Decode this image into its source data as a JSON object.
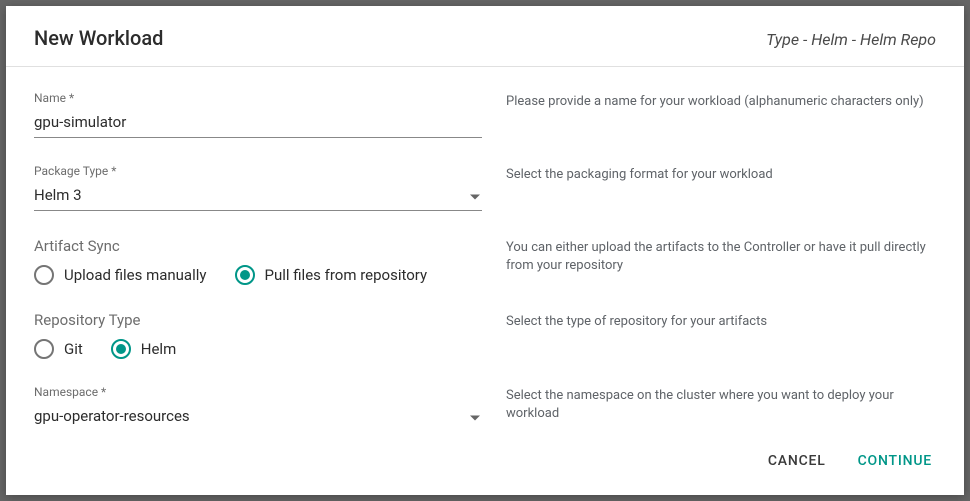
{
  "header": {
    "title": "New Workload",
    "subtitle": "Type - Helm - Helm Repo"
  },
  "fields": {
    "name": {
      "label": "Name *",
      "value": "gpu-simulator",
      "help": "Please provide a name for your workload (alphanumeric characters only)"
    },
    "packageType": {
      "label": "Package Type *",
      "value": "Helm 3",
      "help": "Select the packaging format for your workload"
    },
    "artifactSync": {
      "label": "Artifact Sync",
      "options": {
        "upload": "Upload files manually",
        "pull": "Pull files from repository"
      },
      "help": "You can either upload the artifacts to the Controller or have it pull directly from your repository"
    },
    "repositoryType": {
      "label": "Repository Type",
      "options": {
        "git": "Git",
        "helm": "Helm"
      },
      "help": "Select the type of repository for your artifacts"
    },
    "namespace": {
      "label": "Namespace *",
      "value": "gpu-operator-resources",
      "help": "Select the namespace on the cluster where you want to deploy your workload"
    }
  },
  "footer": {
    "cancel": "CANCEL",
    "continue": "CONTINUE"
  }
}
